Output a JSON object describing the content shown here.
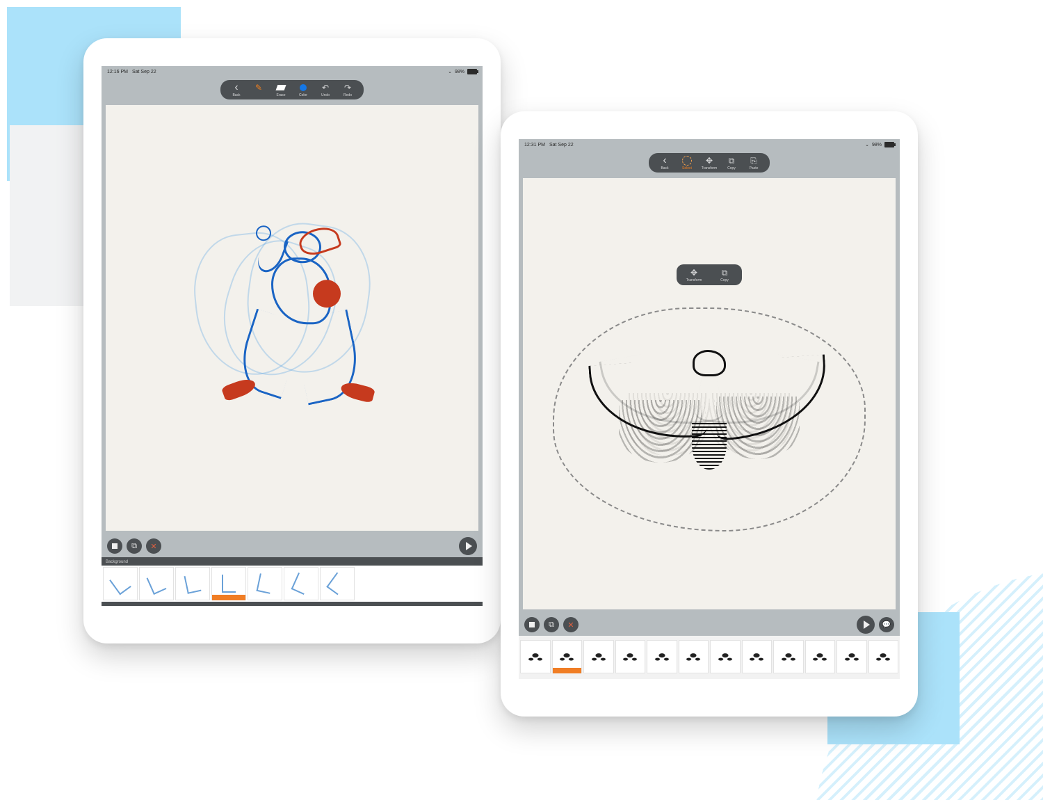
{
  "statusbar": {
    "left_time": "12:16 PM",
    "left_date": "Sat Sep 22",
    "right_time": "12:31 PM",
    "right_date": "Sat Sep 22",
    "battery": "98%"
  },
  "toolbar_left": {
    "back": "Back",
    "brush": "",
    "erase": "Erase",
    "color": "Color",
    "undo": "Undo",
    "redo": "Redo"
  },
  "toolbar_right": {
    "back": "Back",
    "select": "Select",
    "transform": "Transform",
    "copy": "Copy",
    "paste": "Paste"
  },
  "context_menu": {
    "transform": "Transform",
    "copy": "Copy"
  },
  "timeline": {
    "label": "Background",
    "left_frames": [
      false,
      false,
      false,
      true,
      false,
      false,
      false
    ],
    "right_frames": [
      false,
      true,
      false,
      false,
      false,
      false,
      false,
      false,
      false,
      false,
      false,
      false
    ]
  }
}
